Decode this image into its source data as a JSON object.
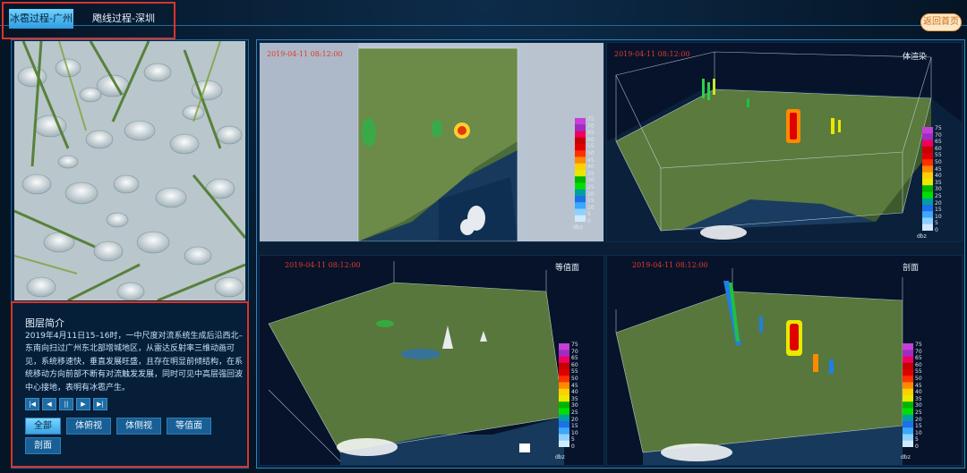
{
  "tabs": [
    {
      "label": "冰雹过程-广州"
    },
    {
      "label": "飑线过程-深圳"
    }
  ],
  "home_label": "返回首页",
  "info": {
    "title": "图层简介",
    "text": "2019年4月11日15–16时，一中尺度对流系统生成后沿西北–东南向扫过广州东北部增城地区，从雷达反射率三维动画可见，系统移速快，垂直发展旺盛，且存在明显前倾结构，在系统移动方向前部不断有对流触发发展，同时可见中高层强回波中心接地，表明有冰雹产生。"
  },
  "player_buttons": [
    "first-icon",
    "prev-icon",
    "pause-icon",
    "next-icon",
    "last-icon"
  ],
  "view_buttons": [
    "全部",
    "体俯视",
    "体侧视",
    "等值面",
    "剖面"
  ],
  "panels": [
    {
      "timestamp": "2019-04-11 08:12:00",
      "caption": ""
    },
    {
      "timestamp": "2019-04-11 08:12:00",
      "caption": "体渲染"
    },
    {
      "timestamp": "2019-04-11 08:12:00",
      "caption": "等值面"
    },
    {
      "timestamp": "2019-04-11 08:12:00",
      "caption": "剖面"
    }
  ],
  "colorbar": {
    "ticks": [
      "75",
      "70",
      "65",
      "60",
      "55",
      "50",
      "45",
      "40",
      "35",
      "30",
      "25",
      "20",
      "15",
      "10",
      "5",
      "0"
    ],
    "colors": [
      "#c640d8",
      "#a02cc0",
      "#f00060",
      "#c80000",
      "#e00000",
      "#ff3000",
      "#ff8a00",
      "#ffd000",
      "#e8e800",
      "#00b400",
      "#00e000",
      "#00a0a0",
      "#1e6fe8",
      "#3aa8ff",
      "#8fd0ff",
      "#cfeaff"
    ],
    "unit": "dbz"
  },
  "colors": {
    "accent": "#2f9be0",
    "border_red": "#d9342b",
    "frame": "#2687c6"
  }
}
